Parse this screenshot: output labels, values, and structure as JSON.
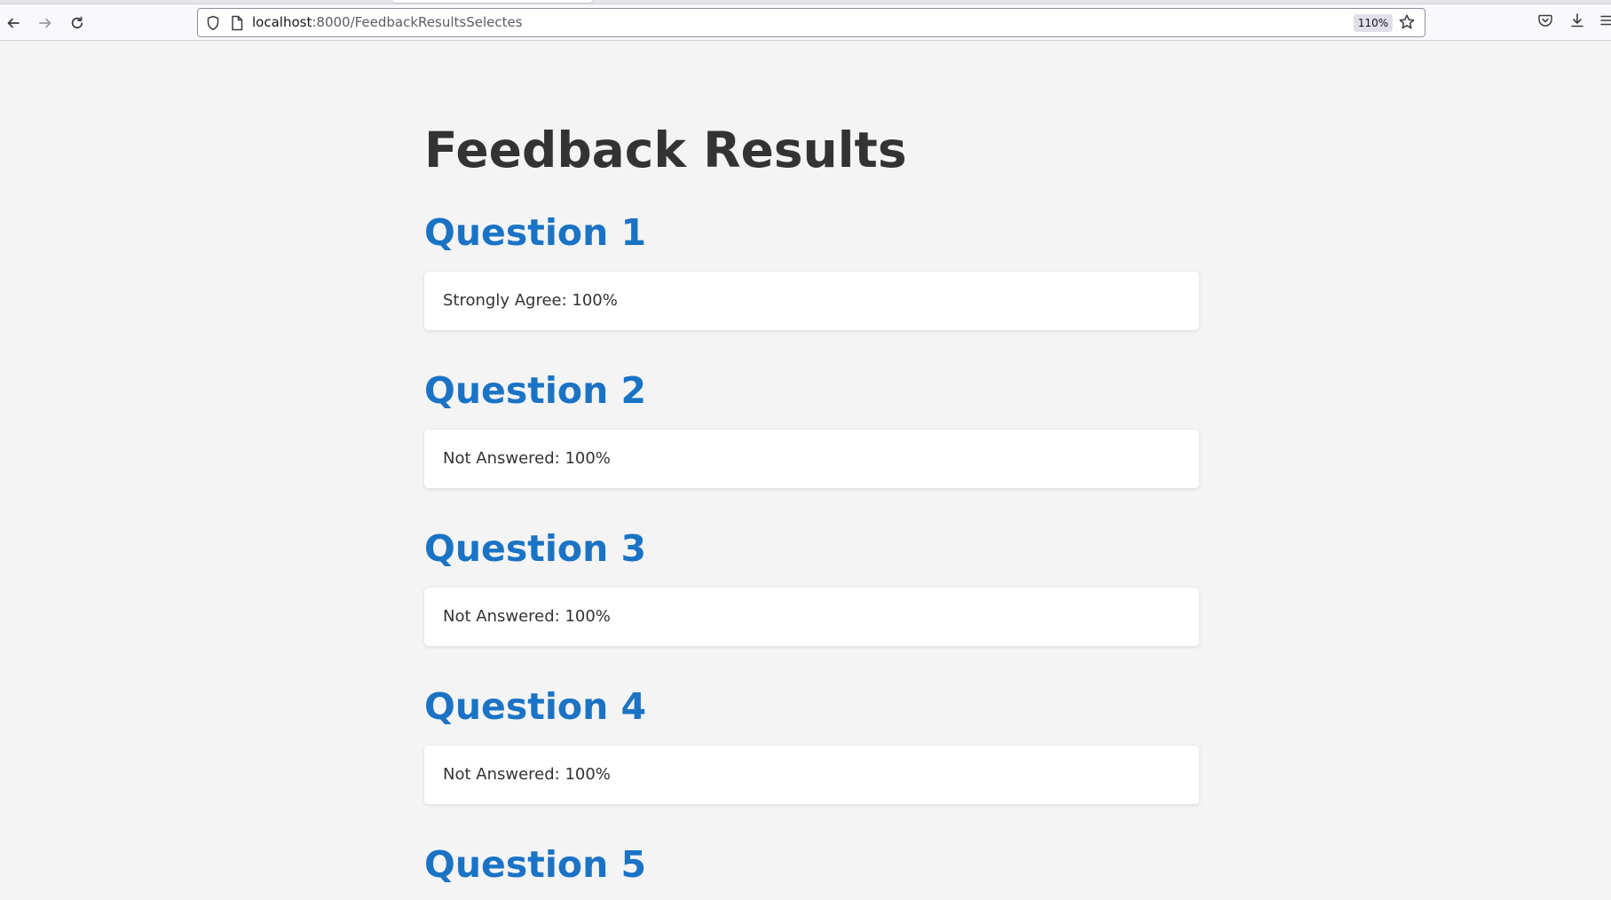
{
  "browser": {
    "url_host": "localhost",
    "url_rest": ":8000/FeedbackResultsSelectes",
    "zoom": "110%"
  },
  "page": {
    "title": "Feedback Results"
  },
  "questions": [
    {
      "title": "Question 1",
      "result": "Strongly Agree: 100%"
    },
    {
      "title": "Question 2",
      "result": "Not Answered: 100%"
    },
    {
      "title": "Question 3",
      "result": "Not Answered: 100%"
    },
    {
      "title": "Question 4",
      "result": "Not Answered: 100%"
    },
    {
      "title": "Question 5",
      "result": ""
    }
  ],
  "colors": {
    "heading": "#333333",
    "question": "#1a73c5",
    "background": "#f4f4f4",
    "card": "#ffffff"
  },
  "icons": [
    "back-arrow-icon",
    "forward-arrow-icon",
    "reload-icon",
    "shield-icon",
    "page-icon",
    "star-icon",
    "pocket-icon",
    "download-icon",
    "menu-icon"
  ]
}
